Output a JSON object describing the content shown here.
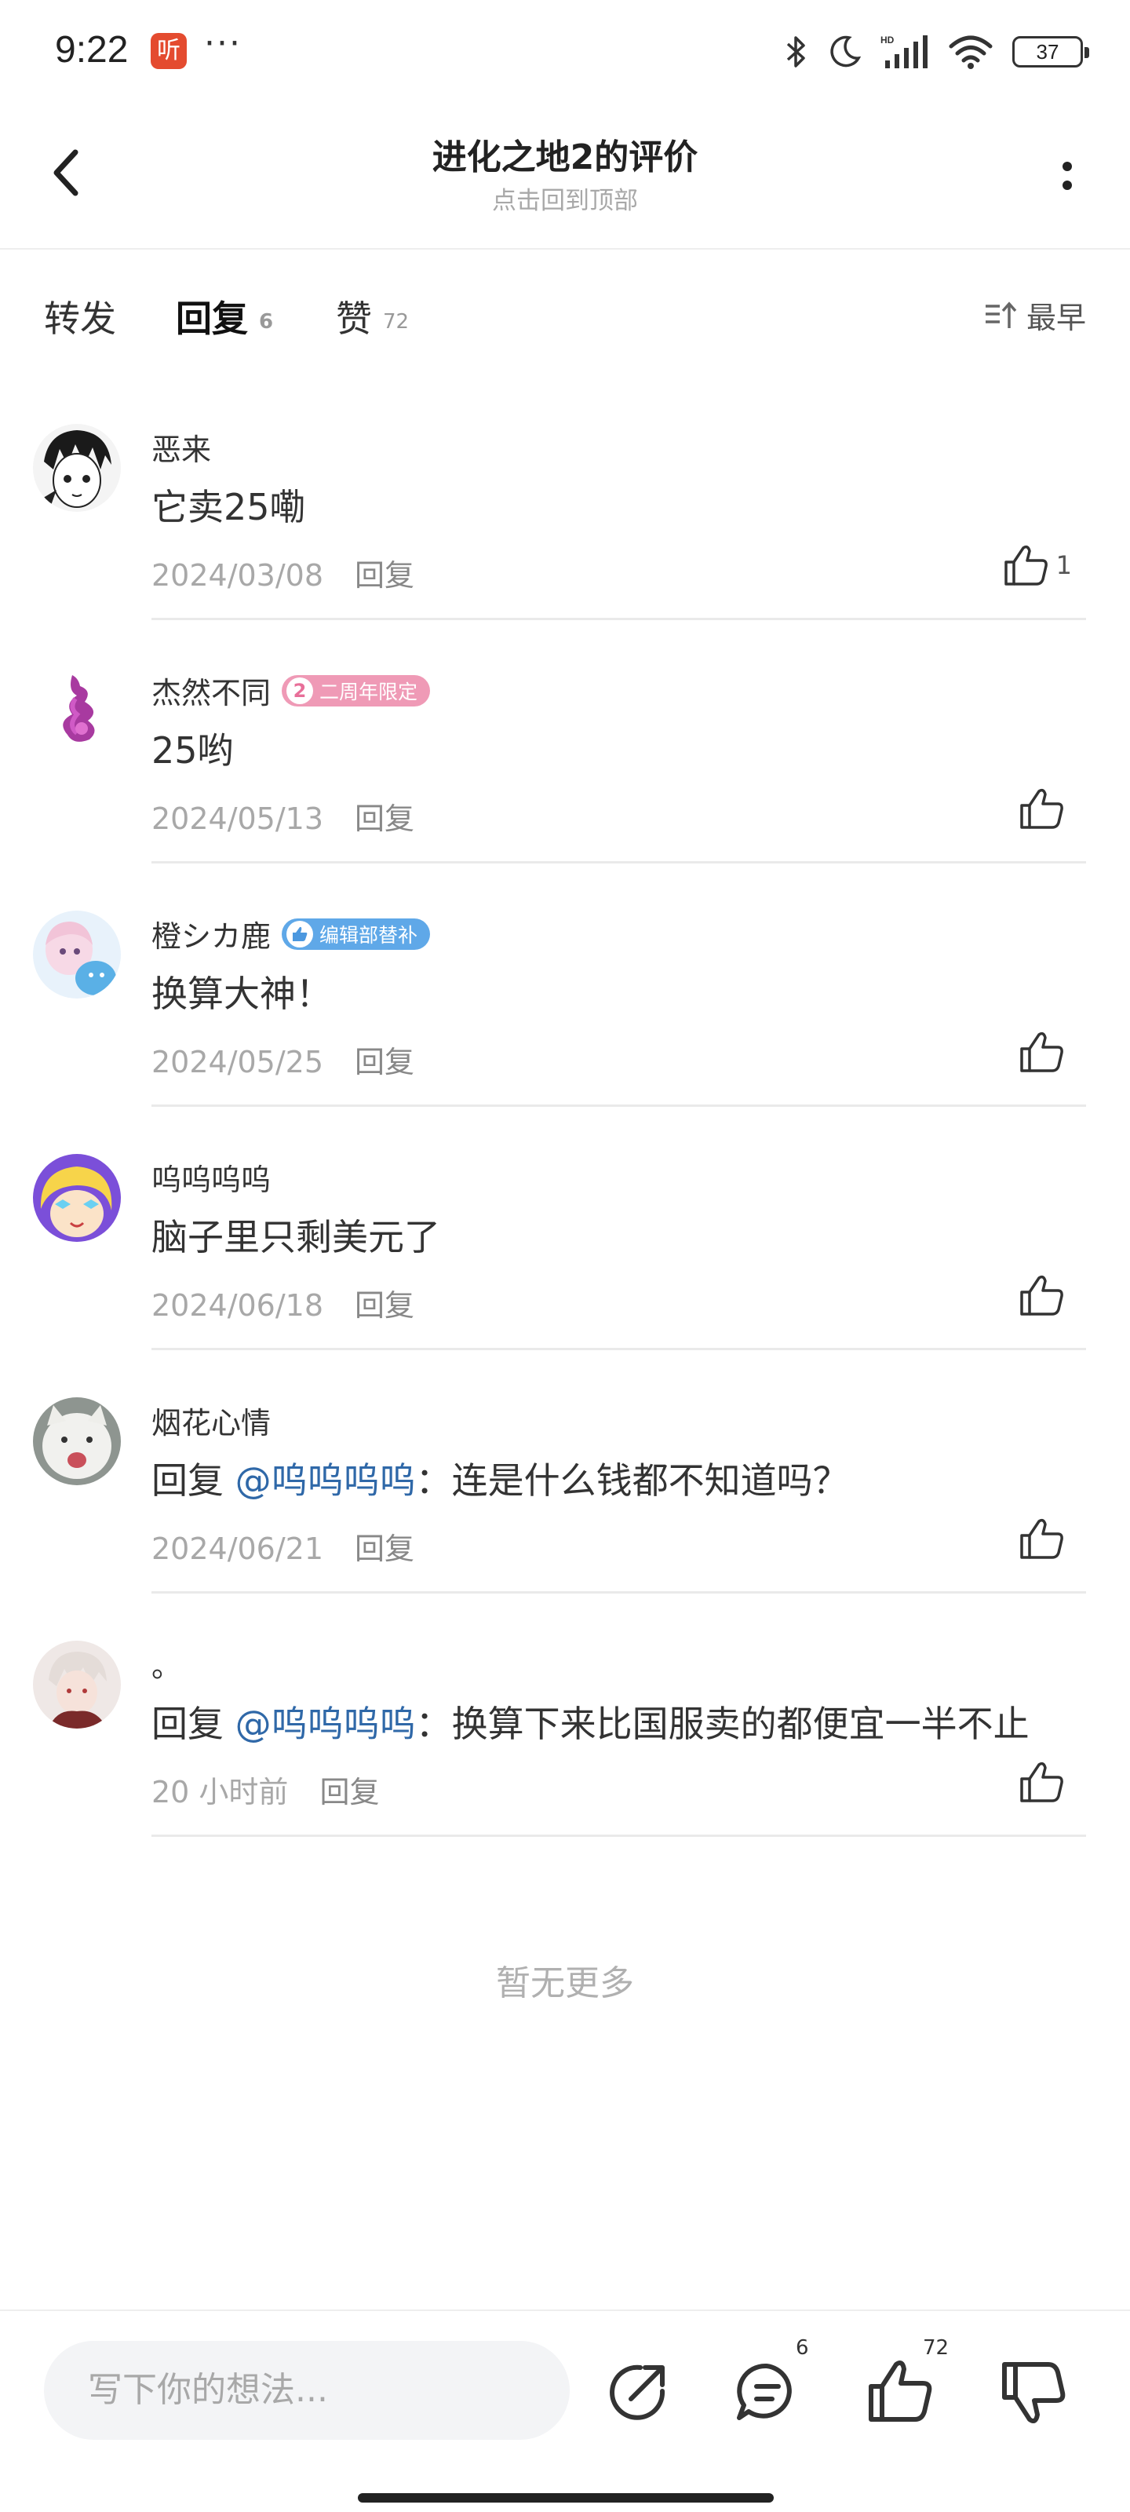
{
  "status_bar": {
    "time": "9:22",
    "app_badge": "听",
    "dots": "···",
    "battery": "37"
  },
  "header": {
    "title": "进化之地2的评价",
    "subtitle": "点击回到顶部"
  },
  "tabs": {
    "forward": {
      "label": "转发"
    },
    "reply": {
      "label": "回复",
      "count": "6"
    },
    "like": {
      "label": "赞",
      "count": "72"
    },
    "sort": "最早"
  },
  "comments": [
    {
      "name": "恶来",
      "text": "它卖25嘞",
      "date": "2024/03/08",
      "reply": "回复",
      "likes": "1",
      "avatar_icon": "manga-avatar"
    },
    {
      "name": "杰然不同",
      "badge": "二周年限定",
      "badge_icon": "2",
      "text": "25哟",
      "date": "2024/05/13",
      "reply": "回复",
      "likes": "",
      "avatar_icon": "smoke-avatar"
    },
    {
      "name": "橙シカ鹿",
      "badge": "编辑部替补",
      "badge_icon": "👍",
      "text": "换算大神！",
      "date": "2024/05/25",
      "reply": "回复",
      "likes": "",
      "avatar_icon": "anime-girl-avatar"
    },
    {
      "name": "呜呜呜呜",
      "text": "脑子里只剩美元了",
      "date": "2024/06/18",
      "reply": "回复",
      "likes": "",
      "avatar_icon": "cartoon-avatar"
    },
    {
      "name": "烟花心情",
      "prefix": "回复 ",
      "mention": "@呜呜呜呜",
      "text": "：连是什么钱都不知道吗？",
      "date": "2024/06/21",
      "reply": "回复",
      "likes": "",
      "avatar_icon": "cat-avatar"
    },
    {
      "name": "。",
      "prefix": "回复 ",
      "mention": "@呜呜呜呜",
      "text": "：换算下来比国服卖的都便宜一半不止",
      "date": "20 小时前",
      "reply": "回复",
      "likes": "",
      "avatar_icon": "character-avatar"
    }
  ],
  "no_more": "暂无更多",
  "bottom_bar": {
    "placeholder": "写下你的想法...",
    "comment_count": "6",
    "like_count": "72"
  },
  "colors": {
    "accent": "#46c8b8",
    "mention": "#2f68a8",
    "badge_pink": "#ef9ab6",
    "badge_blue": "#5fa8e8"
  }
}
